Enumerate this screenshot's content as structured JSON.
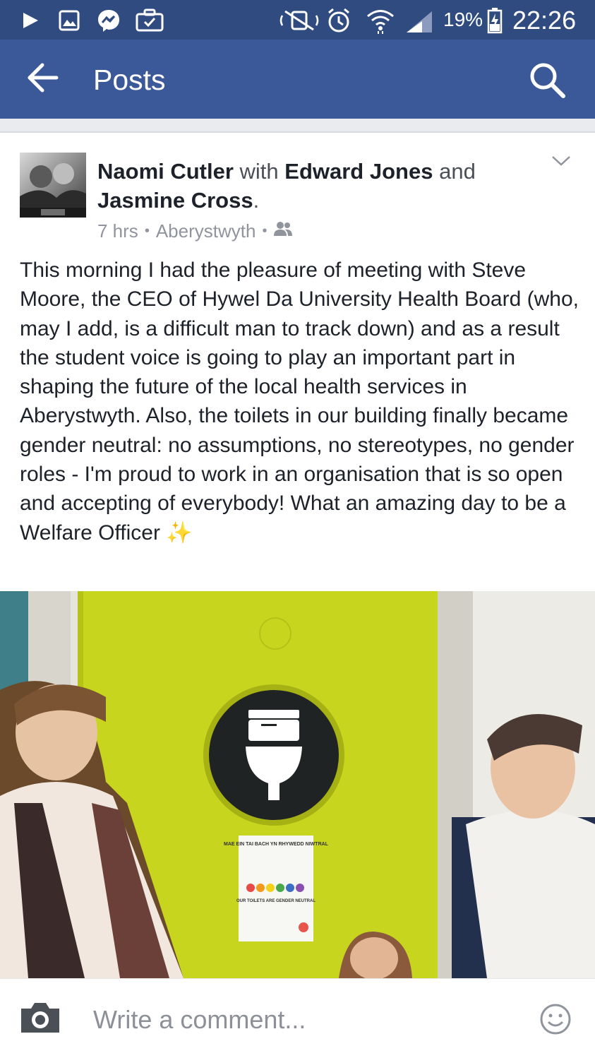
{
  "status_bar": {
    "battery": "19%",
    "time": "22:26",
    "icons": [
      "play-icon",
      "image-icon",
      "messenger-icon",
      "briefcase-icon",
      "nfc-icon",
      "alarm-icon",
      "wifi-icon",
      "signal-icon",
      "battery-charging-icon"
    ]
  },
  "app_bar": {
    "title": "Posts",
    "color": "#3b5998"
  },
  "post": {
    "author": "Naomi Cutler",
    "with_text": " with ",
    "tag1": "Edward Jones",
    "and_text": " and ",
    "tag2": "Jasmine Cross",
    "period": ".",
    "time": "7 hrs",
    "location": "Aberystwyth",
    "dot": "•",
    "audience_icon": "friends-icon",
    "body": "This morning I had the pleasure of meeting with Steve Moore, the CEO of Hywel Da University Health Board (who, may I add, is a difficult man to track down) and as a result the student voice is going to play an important part in shaping the future of the local health services in Aberystwyth. Also, the toilets in our building finally became gender neutral: no assumptions, no stereotypes, no gender roles - I'm proud to work in an organisation that is so open and accepting of everybody! What an amazing day to be a Welfare Officer",
    "emoji": "✨",
    "photo": {
      "sign_title": "MAE EIN TAI BACH YN RHYWEDD NIWTRAL",
      "sign_subtitle": "OUR TOILETS ARE GENDER NEUTRAL"
    }
  },
  "comment_bar": {
    "placeholder": "Write a comment..."
  }
}
